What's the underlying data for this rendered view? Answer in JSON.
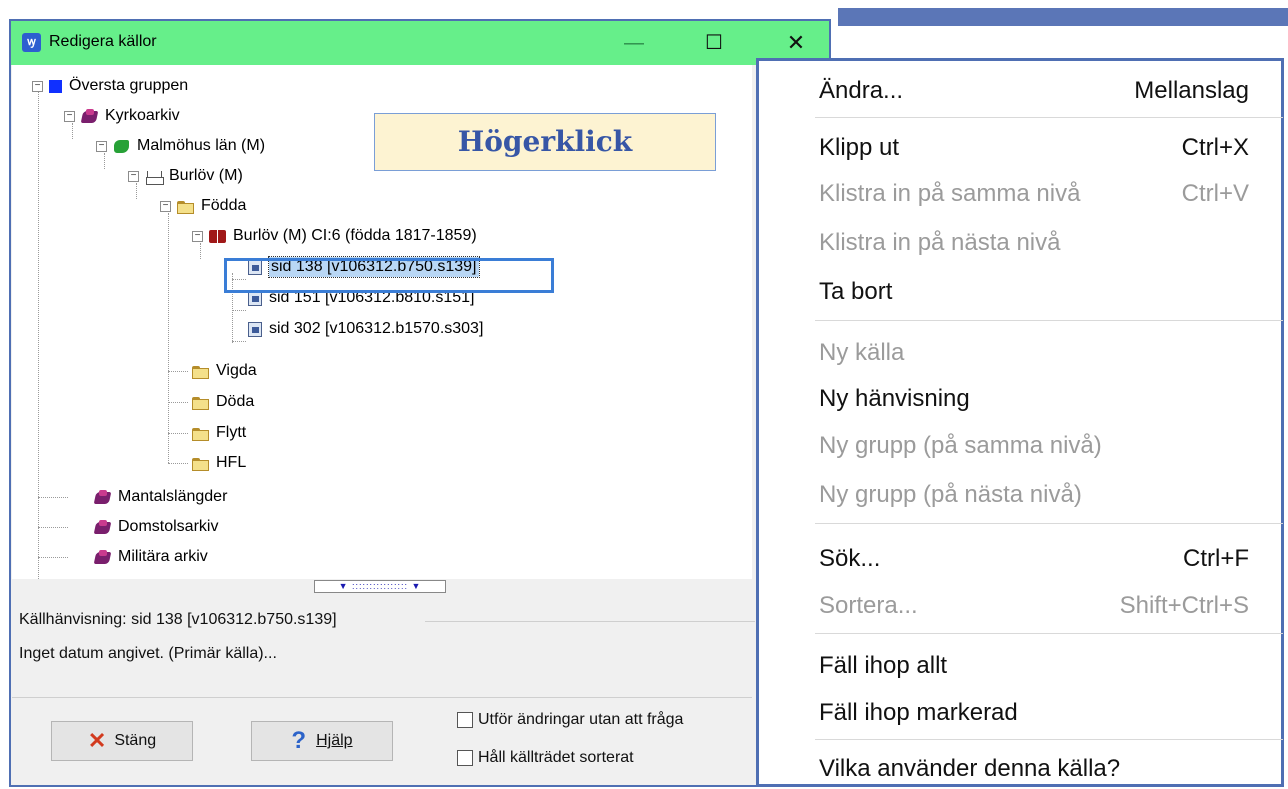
{
  "window": {
    "title": "Redigera källor",
    "app_icon_glyph": "ꝡ",
    "controls": {
      "minimize": "—",
      "maximize": "☐",
      "close": "✕"
    }
  },
  "callout": "Högerklick",
  "tree": {
    "root": "Översta gruppen",
    "kyrkoarkiv": "Kyrkoarkiv",
    "malmohus": "Malmöhus län (M)",
    "burlov": "Burlöv (M)",
    "fodda": "Födda",
    "book": "Burlöv (M) CI:6 (födda 1817-1859)",
    "pages": [
      "sid 138 [v106312.b750.s139]",
      "sid 151 [v106312.b810.s151]",
      "sid 302 [v106312.b1570.s303]"
    ],
    "vigda": "Vigda",
    "doda": "Döda",
    "flytt": "Flytt",
    "hfl": "HFL",
    "mantalslangder": "Mantalslängder",
    "domstolsarkiv": "Domstolsarkiv",
    "militara": "Militära arkiv"
  },
  "splitter": "▼ :::::::::::::::: ▼",
  "info": {
    "label": "Källhänvisning: sid 138 [v106312.b750.s139]",
    "text": "Inget datum angivet. (Primär källa)..."
  },
  "buttons": {
    "close": "Stäng",
    "help": "Hjälp",
    "close_icon": "✕",
    "help_icon": "?"
  },
  "checkboxes": [
    "Utför ändringar utan att fråga",
    "Håll källträdet sorterat"
  ],
  "context_menu": [
    {
      "label": "Ändra...",
      "shortcut": "Mellanslag",
      "enabled": true
    },
    {
      "label": "Klipp ut",
      "shortcut": "Ctrl+X",
      "enabled": true
    },
    {
      "label": "Klistra in på samma nivå",
      "shortcut": "Ctrl+V",
      "enabled": false
    },
    {
      "label": "Klistra in på nästa nivå",
      "shortcut": "",
      "enabled": false
    },
    {
      "label": "Ta bort",
      "shortcut": "",
      "enabled": true
    },
    {
      "label": "Ny källa",
      "shortcut": "",
      "enabled": false
    },
    {
      "label": "Ny hänvisning",
      "shortcut": "",
      "enabled": true
    },
    {
      "label": "Ny grupp (på samma nivå)",
      "shortcut": "",
      "enabled": false
    },
    {
      "label": "Ny grupp (på nästa nivå)",
      "shortcut": "",
      "enabled": false
    },
    {
      "label": "Sök...",
      "shortcut": "Ctrl+F",
      "enabled": true
    },
    {
      "label": "Sortera...",
      "shortcut": "Shift+Ctrl+S",
      "enabled": false
    },
    {
      "label": "Fäll ihop allt",
      "shortcut": "",
      "enabled": true
    },
    {
      "label": "Fäll ihop markerad",
      "shortcut": "",
      "enabled": true
    },
    {
      "label": "Vilka använder denna källa?",
      "shortcut": "",
      "enabled": true
    }
  ],
  "colors": {
    "titlebar": "#66ef8a",
    "frame": "#4f6fb3",
    "selection_box": "#3a7dd6",
    "callout_text": "#3756a6"
  }
}
